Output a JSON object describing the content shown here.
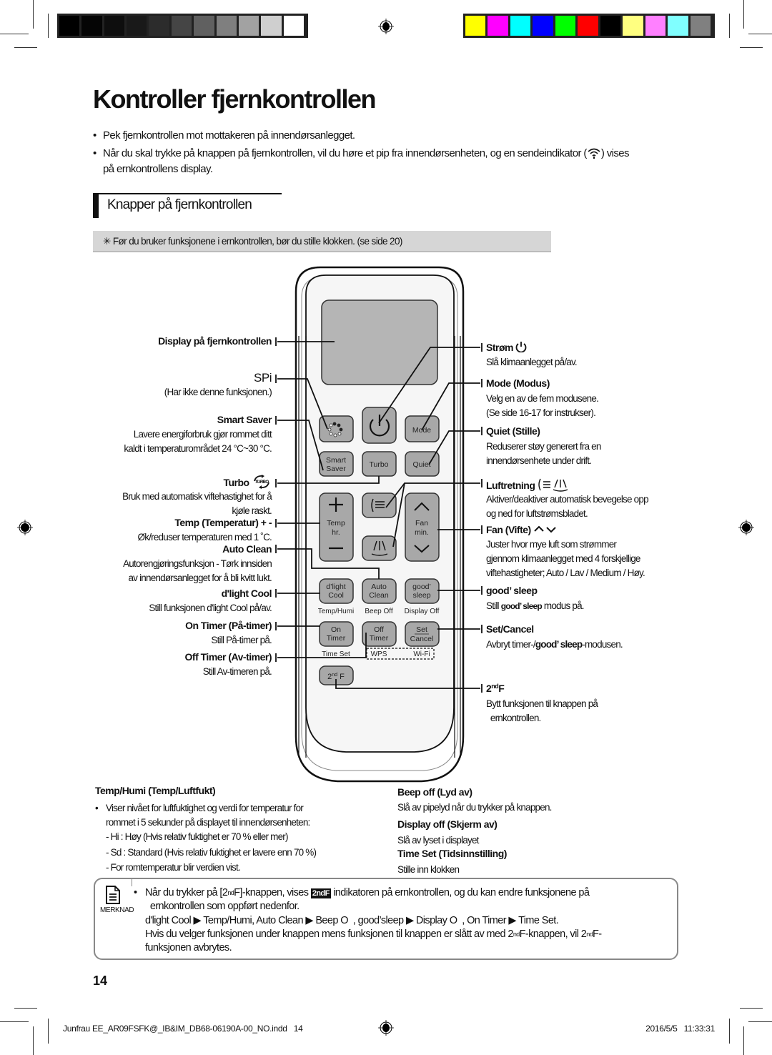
{
  "print_marks": {
    "gray_swatches": [
      "#000000",
      "#050505",
      "#0e0e0e",
      "#191919",
      "#2c2c2c",
      "#454545",
      "#606060",
      "#7f7f7f",
      "#a2a2a2",
      "#cfcfcf",
      "#ffffff"
    ],
    "color_swatches": [
      "#ffff00",
      "#ff00ff",
      "#00ffff",
      "#0000ff",
      "#00ff00",
      "#ff0000",
      "#000000",
      "#ffff80",
      "#ff80ff",
      "#80ffff",
      "#808080"
    ]
  },
  "page": {
    "title": "Kontroller fjernkontrollen",
    "bullets": [
      "Pek fjernkontrollen mot mottakeren på innendørsanlegget.",
      "Når du skal trykke på knappen på fjernkontrollen, vil du høre et pip fra innendørsenheten, og en sendeindikator (",
      ") vises",
      "på   ernkontrollens display."
    ],
    "section_title": "Knapper på fjernkontrollen",
    "notice": "✳ Før du bruker funksjonene i   ernkontrollen, bør du stille klokken. (se side 20)"
  },
  "left_callouts": [
    {
      "label": "Display på fjernkontrollen",
      "desc": []
    },
    {
      "label": "SPi",
      "desc": [
        "(Har ikke denne funksjonen.)"
      ]
    },
    {
      "label": "Smart Saver",
      "desc": [
        "Lavere energiforbruk gjør rommet ditt",
        "kaldt i temperaturområdet 24 °C~30 °C."
      ]
    },
    {
      "label": "Turbo",
      "desc": [
        "Bruk med automatisk viftehastighet for å",
        "kjøle raskt."
      ]
    },
    {
      "label": "Temp (Temperatur) + -",
      "desc": [
        "Øk/reduser temperaturen med 1 ˚C."
      ]
    },
    {
      "label": "Auto Clean",
      "desc": [
        "Autorengjøringsfunksjon - Tørk innsiden",
        "av innendørsanlegget for å bli kvitt lukt."
      ]
    },
    {
      "label": "d'light Cool",
      "desc": [
        "Still funksjonen d'light Cool på/av."
      ]
    },
    {
      "label": "On Timer (På-timer)",
      "desc": [
        "Still På-timer på."
      ]
    },
    {
      "label": "Off Timer (Av-timer)",
      "desc": [
        "Still Av-timeren på."
      ]
    }
  ],
  "right_callouts": [
    {
      "label": "Strøm",
      "desc": [
        "Slå klimaanlegget på/av."
      ]
    },
    {
      "label": "Mode (Modus)",
      "desc": [
        "Velg en av de fem modusene.",
        "(Se side 16-17 for instrukser)."
      ]
    },
    {
      "label": "Quiet (Stille)",
      "desc": [
        "Reduserer støy generert fra en",
        "innendørsenhete under drift."
      ]
    },
    {
      "label": "Luftretning",
      "desc": [
        "Aktiver/deaktiver automatisk bevegelse opp",
        "og ned for luftstrømsbladet."
      ]
    },
    {
      "label": "Fan (Vifte)",
      "desc": [
        "Juster hvor mye luft som strømmer",
        "gjennom klimaanlegget med 4 forskjellige",
        "viftehastigheter; Auto / Lav / Medium / Høy."
      ]
    },
    {
      "label": "good’ sleep",
      "desc_pre": "Still ",
      "desc_bold": "good’ sleep",
      "desc_post": " modus på."
    },
    {
      "label": "Set/Cancel",
      "desc_pre": "Avbryt timer-/",
      "desc_bold": "good’ sleep",
      "desc_post": "-modusen."
    },
    {
      "label_main": "2",
      "label_sup": "nd",
      "label_end": "F",
      "desc": [
        "Bytt funksjonen til knappen på",
        "  ernkontrollen."
      ]
    }
  ],
  "remote": {
    "buttons": {
      "mode": "Mode",
      "smart_saver": [
        "Smart",
        "Saver"
      ],
      "turbo": "Turbo",
      "quiet": "Quiet",
      "temp": [
        "Temp",
        "hr."
      ],
      "fan": [
        "Fan",
        "min."
      ],
      "dlight": [
        "d’light",
        "Cool"
      ],
      "auto_clean": [
        "Auto",
        "Clean"
      ],
      "good_sleep": [
        "good’",
        "sleep"
      ],
      "on_timer": [
        "On",
        "Timer"
      ],
      "off_timer": [
        "Off",
        "Timer"
      ],
      "set_cancel": [
        "Set",
        "Cancel"
      ],
      "second_f": [
        "2",
        "nd",
        " F"
      ]
    },
    "sublabels": {
      "temp_humi": "Temp/Humi",
      "beep_off": "Beep Off",
      "display_off": "Display Off",
      "time_set": "Time Set",
      "wps": "WPS",
      "wifi": "Wi-Fi"
    }
  },
  "bottom": {
    "temp_humi": {
      "heading": "Temp/Humi (Temp/Luftfukt)",
      "lines": [
        "Viser nivået for luftfuktighet og verdi for temperatur for",
        "rommet i 5 sekunder på displayet til innendørsenheten:",
        "- Hi : Høy (Hvis relativ fuktighet er 70 % eller mer)",
        "- Sd : Standard (Hvis relativ fuktighet er lavere enn 70 %)",
        "- For romtemperatur blir verdien vist."
      ]
    },
    "beep_off": {
      "heading": "Beep off (Lyd av)",
      "text": "Slå av pipelyd når du trykker på knappen."
    },
    "display_off": {
      "heading": "Display off (Skjerm av)",
      "text": "Slå av lyset i displayet"
    },
    "time_set": {
      "heading": "Time Set (Tidsinnstilling)",
      "text": "Stille inn klokken"
    }
  },
  "merknad": {
    "icon_label": "MERKNAD",
    "line1_a": "Når du trykker på [2",
    "line1_sup": "nd",
    "line1_b": "F]-knappen, vises ",
    "badge": "2ndF",
    "line1_c": " indikatoren på   ernkontrollen, og du kan endre funksjonene på",
    "line2": "  ernkontrollen som oppført nedenfor.",
    "line3": "d'light Cool ▶ Temp/Humi, Auto Clean ▶ Beep O  , good’sleep ▶ Display O  , On Timer ▶ Time Set.",
    "line4_a": "Hvis du velger funksjonen under knappen mens funksjonen til knappen er slått av med 2",
    "line4_sup1": "nd",
    "line4_b": "F-knappen, vil 2",
    "line4_sup2": "nd",
    "line4_c": "F-",
    "line5": "funksjonen avbrytes."
  },
  "page_number": "14",
  "footer": {
    "file": "Junfrau EE_AR09FSFK@_IB&IM_DB68-06190A-00_NO.indd   14",
    "date": "2016/5/5   11:33:31"
  }
}
